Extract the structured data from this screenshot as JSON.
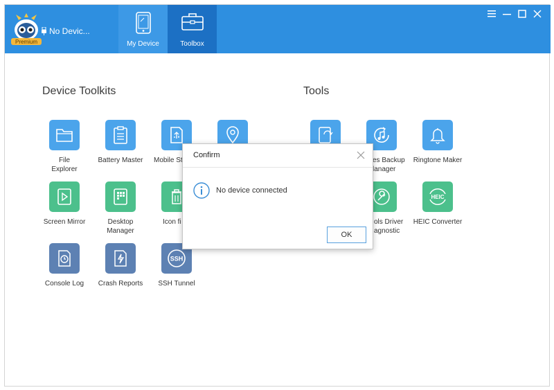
{
  "app": {
    "badge": "Premium",
    "device_status": "No Devic...",
    "colors": {
      "header": "#2e8fe0",
      "tab_active": "#1c70c4",
      "tile_blue": "#4ba4eb",
      "tile_green": "#4cc08c",
      "tile_slate": "#5d81b3"
    }
  },
  "nav": {
    "tabs": [
      {
        "label": "My Device",
        "icon": "phone-icon"
      },
      {
        "label": "Toolbox",
        "icon": "toolbox-icon",
        "active": true
      }
    ]
  },
  "window_controls": [
    "menu-icon",
    "minimize-icon",
    "maximize-icon",
    "close-icon"
  ],
  "device_toolkits": {
    "title": "Device Toolkits",
    "items": [
      {
        "label": "File Explorer",
        "icon": "folder-icon"
      },
      {
        "label": "Battery Master",
        "icon": "clipboard-icon"
      },
      {
        "label": "Mobile St",
        "icon": "usb-storage-icon"
      },
      {
        "label": "",
        "icon": "location-pin-icon"
      },
      {
        "label": "Screen Mirror",
        "icon": "play-icon"
      },
      {
        "label": "Desktop Manager",
        "icon": "grid-icon"
      },
      {
        "label": "Icon fi",
        "icon": "trash-icon"
      },
      {
        "label": "Console Log",
        "icon": "clock-icon"
      },
      {
        "label": "Crash Reports",
        "icon": "lightning-icon"
      },
      {
        "label": "SSH Tunnel",
        "icon": "ssh-icon"
      }
    ]
  },
  "tools": {
    "title": "Tools",
    "items": [
      {
        "label": "",
        "icon": "transfer-icon"
      },
      {
        "label": "es Backup lanager",
        "icon": "music-note-icon"
      },
      {
        "label": "Ringtone Maker",
        "icon": "bell-icon"
      },
      {
        "label": "ols Driver agnostic",
        "icon": "wrench-icon"
      },
      {
        "label": "HEIC Converter",
        "icon": "heic-icon"
      }
    ]
  },
  "dialog": {
    "title": "Confirm",
    "message": "No device connected",
    "ok_label": "OK"
  }
}
